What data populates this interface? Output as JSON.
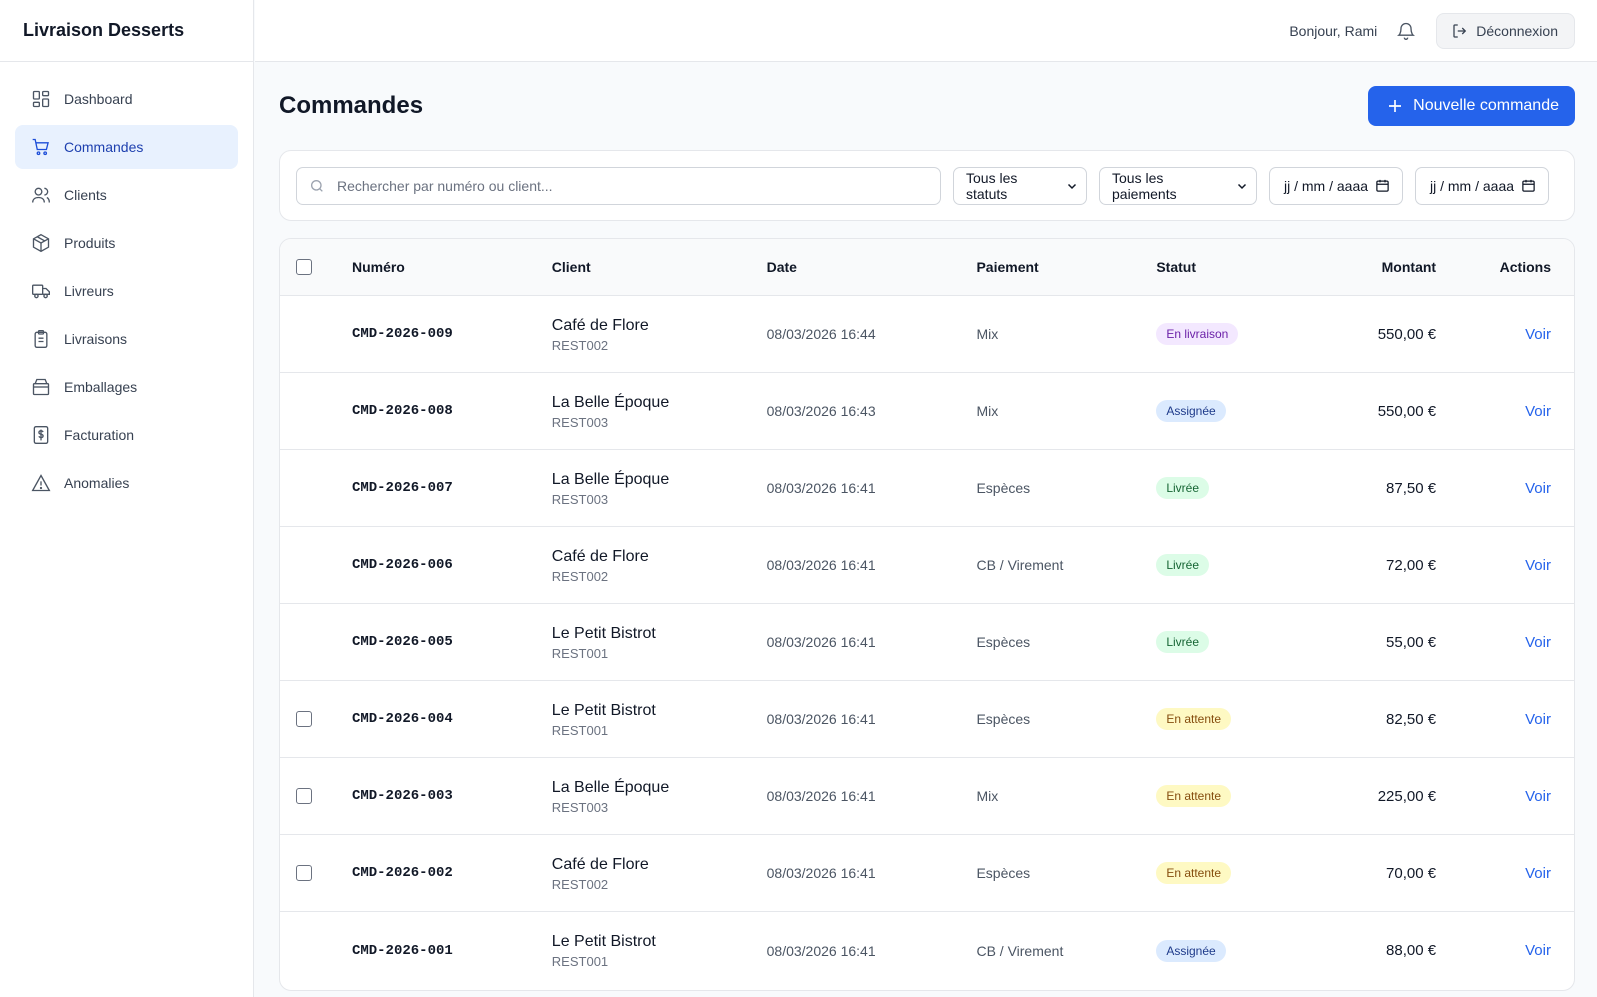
{
  "app": {
    "brand": "Livraison Desserts"
  },
  "sidebar": {
    "items": [
      {
        "label": "Dashboard",
        "icon": "dashboard-icon"
      },
      {
        "label": "Commandes",
        "icon": "cart-icon",
        "active": true
      },
      {
        "label": "Clients",
        "icon": "users-icon"
      },
      {
        "label": "Produits",
        "icon": "box-icon"
      },
      {
        "label": "Livreurs",
        "icon": "truck-icon"
      },
      {
        "label": "Livraisons",
        "icon": "clipboard-icon"
      },
      {
        "label": "Emballages",
        "icon": "package-icon"
      },
      {
        "label": "Facturation",
        "icon": "invoice-icon"
      },
      {
        "label": "Anomalies",
        "icon": "warning-icon"
      }
    ]
  },
  "topbar": {
    "greeting": "Bonjour, Rami",
    "logout_label": "Déconnexion"
  },
  "page": {
    "title": "Commandes",
    "new_order_label": "Nouvelle commande"
  },
  "filters": {
    "search_placeholder": "Rechercher par numéro ou client...",
    "status_value": "Tous les statuts",
    "payment_value": "Tous les paiements",
    "date_from": "jj / mm / aaaa",
    "date_to": "jj / mm / aaaa"
  },
  "table": {
    "headers": {
      "number": "Numéro",
      "client": "Client",
      "date": "Date",
      "payment": "Paiement",
      "status": "Statut",
      "amount": "Montant",
      "actions": "Actions"
    },
    "rows": [
      {
        "number": "CMD-2026-009",
        "client": "Café de Flore",
        "code": "REST002",
        "date": "08/03/2026 16:44",
        "payment": "Mix",
        "status": "En livraison",
        "amount": "550,00 €",
        "action": "Voir"
      },
      {
        "number": "CMD-2026-008",
        "client": "La Belle Époque",
        "code": "REST003",
        "date": "08/03/2026 16:43",
        "payment": "Mix",
        "status": "Assignée",
        "amount": "550,00 €",
        "action": "Voir"
      },
      {
        "number": "CMD-2026-007",
        "client": "La Belle Époque",
        "code": "REST003",
        "date": "08/03/2026 16:41",
        "payment": "Espèces",
        "status": "Livrée",
        "amount": "87,50 €",
        "action": "Voir"
      },
      {
        "number": "CMD-2026-006",
        "client": "Café de Flore",
        "code": "REST002",
        "date": "08/03/2026 16:41",
        "payment": "CB / Virement",
        "status": "Livrée",
        "amount": "72,00 €",
        "action": "Voir"
      },
      {
        "number": "CMD-2026-005",
        "client": "Le Petit Bistrot",
        "code": "REST001",
        "date": "08/03/2026 16:41",
        "payment": "Espèces",
        "status": "Livrée",
        "amount": "55,00 €",
        "action": "Voir"
      },
      {
        "number": "CMD-2026-004",
        "client": "Le Petit Bistrot",
        "code": "REST001",
        "date": "08/03/2026 16:41",
        "payment": "Espèces",
        "status": "En attente",
        "amount": "82,50 €",
        "action": "Voir"
      },
      {
        "number": "CMD-2026-003",
        "client": "La Belle Époque",
        "code": "REST003",
        "date": "08/03/2026 16:41",
        "payment": "Mix",
        "status": "En attente",
        "amount": "225,00 €",
        "action": "Voir"
      },
      {
        "number": "CMD-2026-002",
        "client": "Café de Flore",
        "code": "REST002",
        "date": "08/03/2026 16:41",
        "payment": "Espèces",
        "status": "En attente",
        "amount": "70,00 €",
        "action": "Voir"
      },
      {
        "number": "CMD-2026-001",
        "client": "Le Petit Bistrot",
        "code": "REST001",
        "date": "08/03/2026 16:41",
        "payment": "CB / Virement",
        "status": "Assignée",
        "amount": "88,00 €",
        "action": "Voir"
      }
    ]
  },
  "colors": {
    "accent": "#2563eb",
    "active_nav_bg": "#e8f1fe",
    "badge_en_livraison": "#f3e8ff",
    "badge_assignee": "#dbeafe",
    "badge_livree": "#dcfce7",
    "badge_en_attente": "#fef9c3"
  }
}
